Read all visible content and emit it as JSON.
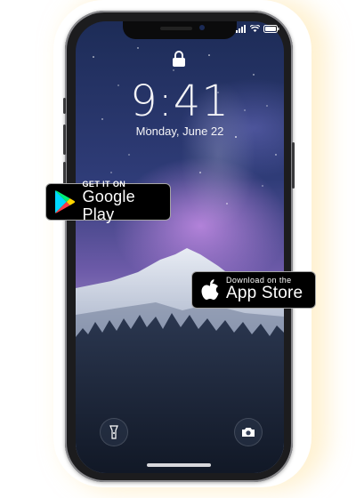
{
  "lockscreen": {
    "time": "9:41",
    "date": "Monday, June 22",
    "lock_icon": "lock-icon",
    "flashlight_icon": "flashlight-icon",
    "camera_icon": "camera-icon"
  },
  "status_bar": {
    "icons": [
      "cellular-signal-icon",
      "wifi-icon",
      "battery-icon"
    ]
  },
  "badges": {
    "google_play": {
      "small": "GET IT ON",
      "big": "Google Play",
      "icon": "google-play-icon"
    },
    "app_store": {
      "small": "Download on the",
      "big": "App Store",
      "icon": "apple-icon"
    }
  },
  "colors": {
    "badge_bg": "#000000",
    "badge_border": "#a6a6a6",
    "frame": "#1c1c1e",
    "glow": "#ffe6aa"
  }
}
